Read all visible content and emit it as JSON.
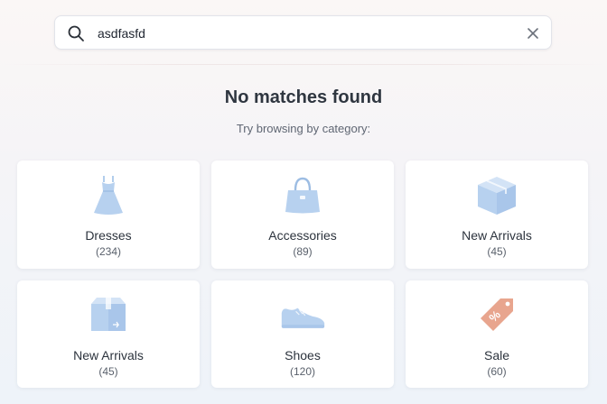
{
  "search": {
    "value": "asdfasfd",
    "icon": "search-icon",
    "clear_icon": "close-icon"
  },
  "empty_state": {
    "title": "No matches found",
    "subtitle": "Try browsing by category:"
  },
  "categories": [
    {
      "label": "Dresses",
      "count": "(234)",
      "icon": "dress-icon",
      "color": "#a9c8ea"
    },
    {
      "label": "Accessories",
      "count": "(89)",
      "icon": "handbag-icon",
      "color": "#a9c8ea"
    },
    {
      "label": "New Arrivals",
      "count": "(45)",
      "icon": "box-icon",
      "color": "#a9c8ea"
    },
    {
      "label": "New Arrivals",
      "count": "(45)",
      "icon": "package-icon",
      "color": "#a9c8ea"
    },
    {
      "label": "Shoes",
      "count": "(120)",
      "icon": "shoe-icon",
      "color": "#a9c8ea"
    },
    {
      "label": "Sale",
      "count": "(60)",
      "icon": "sale-tag-icon",
      "color": "#e8a58e"
    }
  ]
}
